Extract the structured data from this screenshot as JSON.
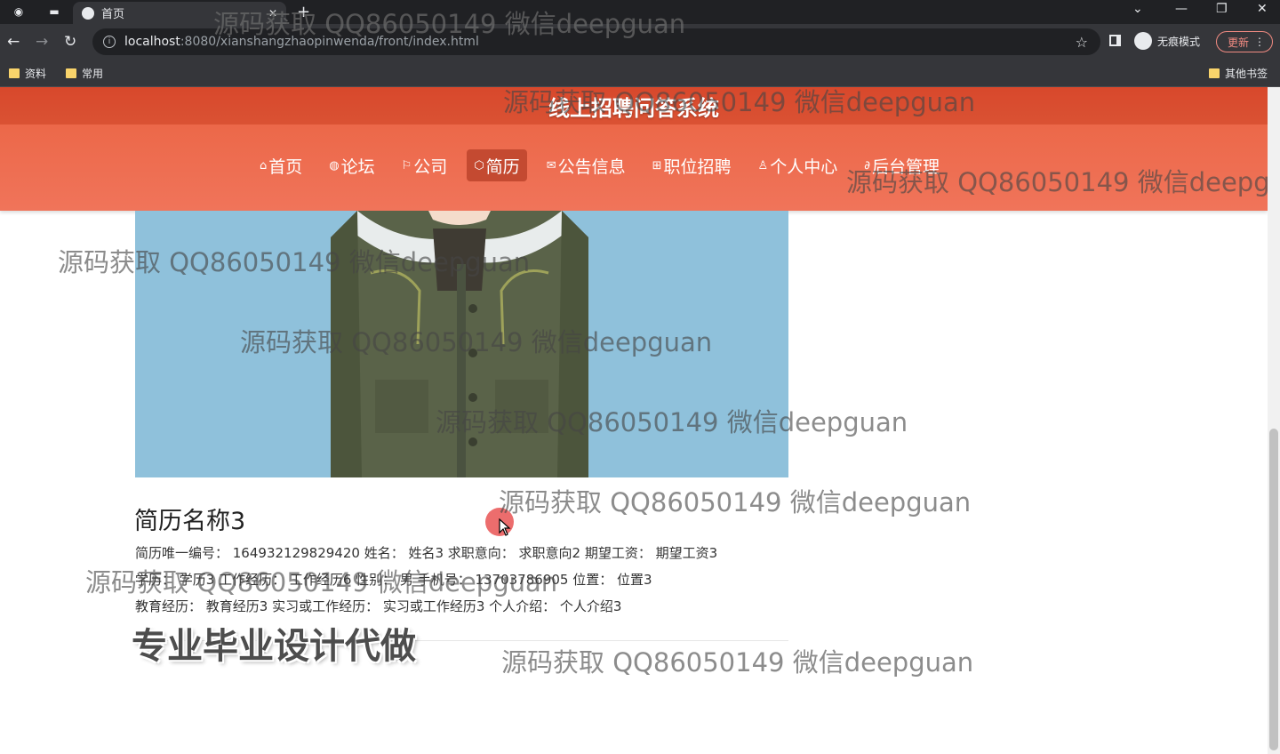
{
  "browser": {
    "tab_title": "首页",
    "url_host": "localhost",
    "url_path": ":8080/xianshangzhaopinwenda/front/index.html",
    "incognito_label": "无痕模式",
    "update_label": "更新",
    "bookmarks": [
      "资料",
      "常用"
    ],
    "other_bookmarks": "其他书签"
  },
  "site": {
    "title": "线上招聘问答系统",
    "menu": [
      {
        "icon": "home-icon",
        "glyph": "⌂",
        "label": "首页"
      },
      {
        "icon": "forum-icon",
        "glyph": "◍",
        "label": "论坛"
      },
      {
        "icon": "flag-icon",
        "glyph": "⚐",
        "label": "公司"
      },
      {
        "icon": "resume-icon",
        "glyph": "⬡",
        "label": "简历",
        "active": true
      },
      {
        "icon": "mail-icon",
        "glyph": "✉",
        "label": "公告信息"
      },
      {
        "icon": "gift-icon",
        "glyph": "⊞",
        "label": "职位招聘"
      },
      {
        "icon": "user-icon",
        "glyph": "♙",
        "label": "个人中心"
      },
      {
        "icon": "link-icon",
        "glyph": "∂",
        "label": "后台管理"
      }
    ]
  },
  "resume": {
    "name": "简历名称3",
    "line1": "简历唯一编号： 164932129829420    姓名： 姓名3    求职意向： 求职意向2    期望工资： 期望工资3",
    "line2": "学历： 学历3    工作经历： 工作经历6    性别： 男    手机号： 13703786905    位置： 位置3",
    "line3": "教育经历： 教育经历3    实习或工作经历： 实习或工作经历3    个人介绍： 个人介绍3"
  },
  "watermarks": {
    "text": "源码获取 QQ86050149 微信deepguan",
    "big": "专业毕业设计代做"
  },
  "colors": {
    "header": "#ec6849",
    "menu_active": "#c44a31",
    "photo_bg": "#8fc1db"
  }
}
